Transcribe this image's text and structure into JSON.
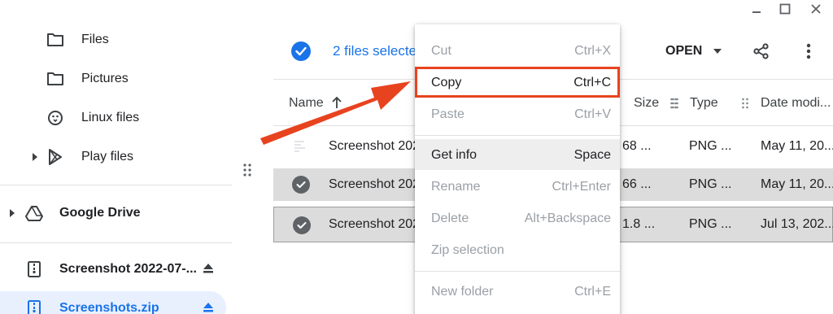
{
  "window": {
    "minimize_icon": "minimize-icon",
    "maximize_icon": "maximize-icon",
    "close_icon": "close-icon"
  },
  "sidebar": {
    "items": [
      {
        "label": "Files",
        "icon": "folder-icon"
      },
      {
        "label": "Pictures",
        "icon": "folder-icon"
      },
      {
        "label": "Linux files",
        "icon": "penguin-icon"
      },
      {
        "label": "Play files",
        "icon": "play-store-icon"
      },
      {
        "label": "Google Drive",
        "icon": "google-drive-icon"
      },
      {
        "label": "Screenshot 2022-07-...",
        "icon": "zip-icon"
      },
      {
        "label": "Screenshots.zip",
        "icon": "zip-icon"
      }
    ]
  },
  "toolbar": {
    "selection_text": "2 files selecte",
    "open_label": "OPEN"
  },
  "list": {
    "columns": {
      "name": "Name",
      "size": "Size",
      "type": "Type",
      "date": "Date modi..."
    },
    "rows": [
      {
        "name": "Screenshot 202",
        "size": "68 ...",
        "type": "PNG ...",
        "date": "May 11, 20..."
      },
      {
        "name": "Screenshot 202",
        "size": "66 ...",
        "type": "PNG ...",
        "date": "May 11, 20..."
      },
      {
        "name": "Screenshot 202",
        "size": "1.8 ...",
        "type": "PNG ...",
        "date": "Jul 13, 202..."
      }
    ]
  },
  "context_menu": {
    "items": [
      {
        "label": "Cut",
        "shortcut": "Ctrl+X"
      },
      {
        "label": "Copy",
        "shortcut": "Ctrl+C"
      },
      {
        "label": "Paste",
        "shortcut": "Ctrl+V"
      },
      {
        "label": "Get info",
        "shortcut": "Space"
      },
      {
        "label": "Rename",
        "shortcut": "Ctrl+Enter"
      },
      {
        "label": "Delete",
        "shortcut": "Alt+Backspace"
      },
      {
        "label": "Zip selection",
        "shortcut": ""
      },
      {
        "label": "New folder",
        "shortcut": "Ctrl+E"
      }
    ]
  },
  "colors": {
    "accent": "#1a73e8",
    "annotation": "#e8431f"
  }
}
